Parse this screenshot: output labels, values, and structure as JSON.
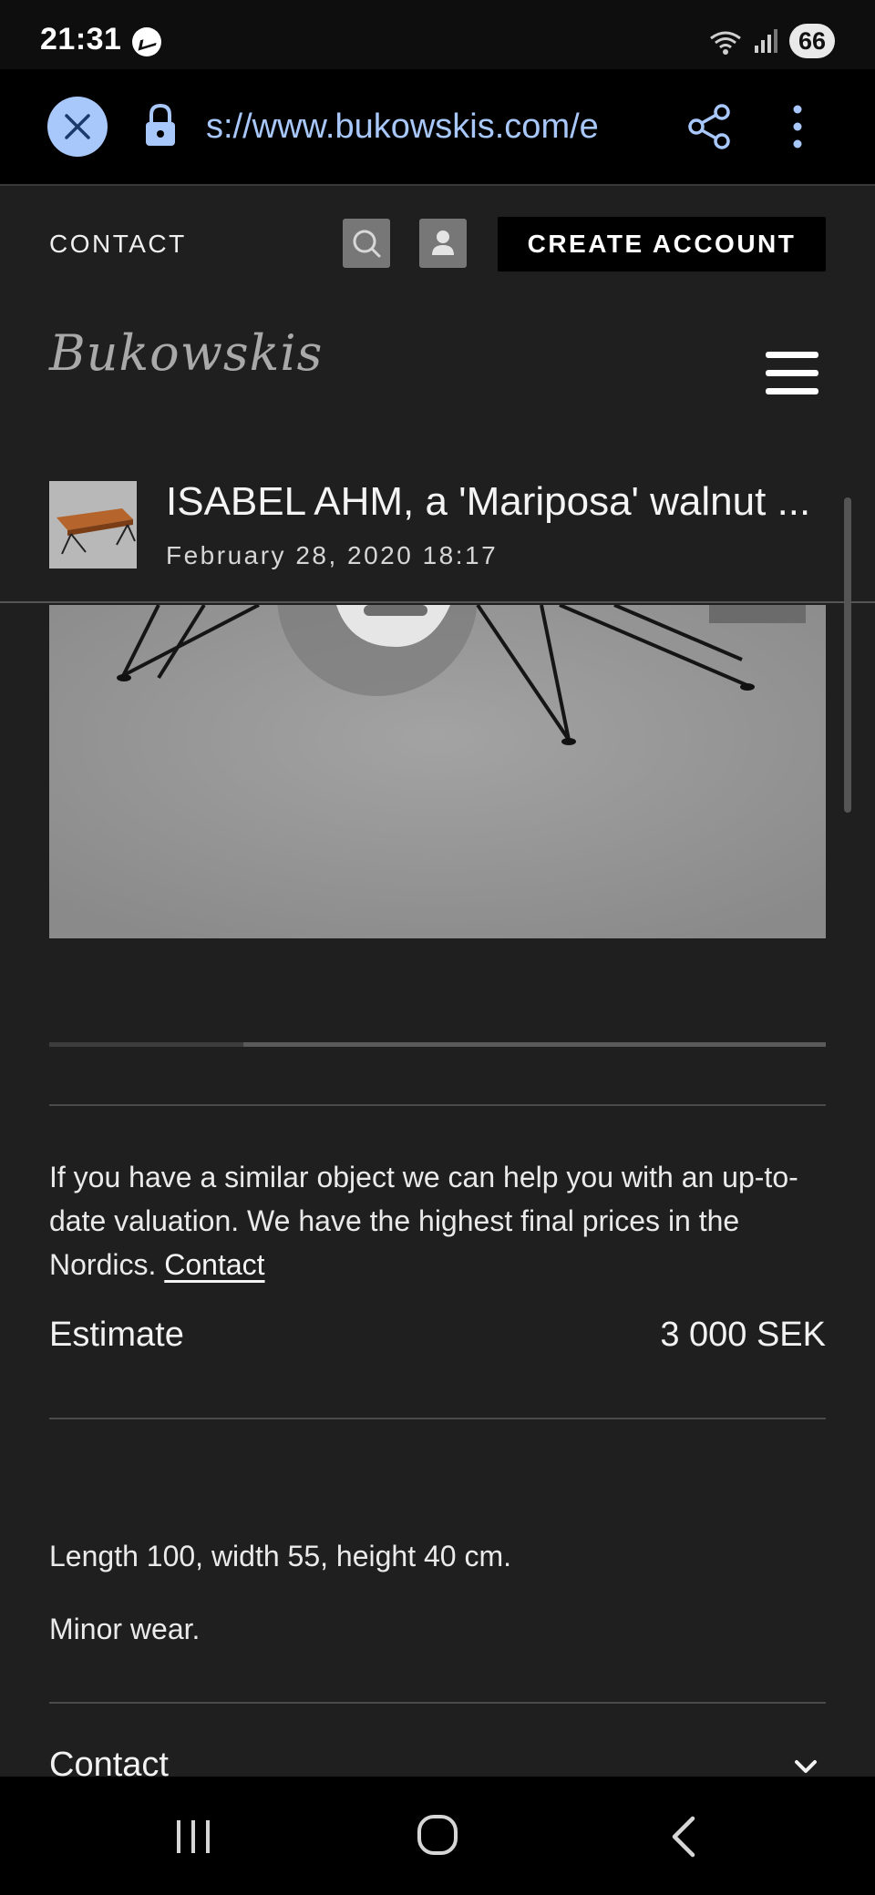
{
  "status_bar": {
    "time": "21:31",
    "battery": "66"
  },
  "browser": {
    "url": "s://www.bukowskis.com/e"
  },
  "header": {
    "contact": "CONTACT",
    "create_account": "CREATE ACCOUNT",
    "logo": "Bukowskis"
  },
  "item": {
    "title": "ISABEL AHM, a 'Mariposa' walnut ...",
    "date": "February 28, 2020 18:17"
  },
  "gallery": {
    "progress": 0.25
  },
  "valuation": {
    "text": "If you have a similar object we can help you with an up-to-date valuation. We have the highest final prices in the Nordics. ",
    "link": "Contact"
  },
  "estimate": {
    "label": "Estimate",
    "value": "3 000 SEK"
  },
  "description": {
    "dimensions": "Length 100, width 55, height 40 cm.",
    "condition": "Minor wear."
  },
  "accordion": {
    "contact": "Contact"
  },
  "colors": {
    "background": "#1f1f1f",
    "accent": "#a8c7fa"
  }
}
